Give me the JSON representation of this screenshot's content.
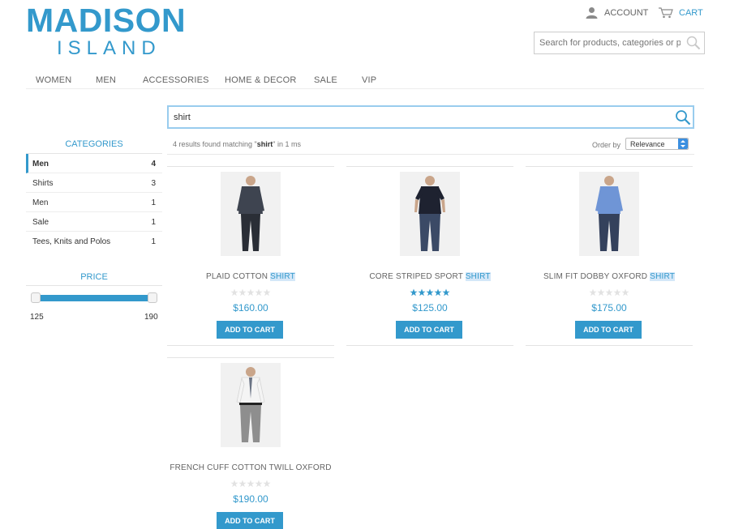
{
  "brand": {
    "line1": "MADISON",
    "line2": "ISLAND"
  },
  "header": {
    "account_label": "ACCOUNT",
    "cart_label": "CART",
    "search_placeholder": "Search for products, categories or pa"
  },
  "nav": {
    "items": [
      "WOMEN",
      "MEN",
      "ACCESSORIES",
      "HOME & DECOR",
      "SALE",
      "VIP"
    ]
  },
  "sidebar": {
    "categories_title": "CATEGORIES",
    "categories": [
      {
        "name": "Men",
        "count": "4",
        "active": true
      },
      {
        "name": "Shirts",
        "count": "3"
      },
      {
        "name": "Men",
        "count": "1"
      },
      {
        "name": "Sale",
        "count": "1"
      },
      {
        "name": "Tees, Knits and Polos",
        "count": "1"
      }
    ],
    "price_title": "PRICE",
    "price_min": "125",
    "price_max": "190"
  },
  "search": {
    "query": "shirt",
    "results_prefix": "4 results found matching \"",
    "results_term": "shirt",
    "results_suffix": "\" in 1 ms",
    "order_label": "Order by",
    "order_value": "Relevance"
  },
  "products": [
    {
      "name_main": "PLAID COTTON ",
      "name_highlight": "SHIRT",
      "price": "$160.00",
      "rating": 0,
      "button": "ADD TO CART"
    },
    {
      "name_main": "CORE STRIPED SPORT ",
      "name_highlight": "SHIRT",
      "price": "$125.00",
      "rating": 5,
      "button": "ADD TO CART"
    },
    {
      "name_main": "SLIM FIT DOBBY OXFORD ",
      "name_highlight": "SHIRT",
      "price": "$175.00",
      "rating": 0,
      "button": "ADD TO CART"
    },
    {
      "name_main": "FRENCH CUFF COTTON TWILL OXFORD",
      "name_highlight": "",
      "price": "$190.00",
      "rating": 0,
      "button": "ADD TO CART"
    }
  ],
  "colors": {
    "accent": "#3399cc",
    "text": "#636363",
    "highlight": "#d4e7f8"
  }
}
